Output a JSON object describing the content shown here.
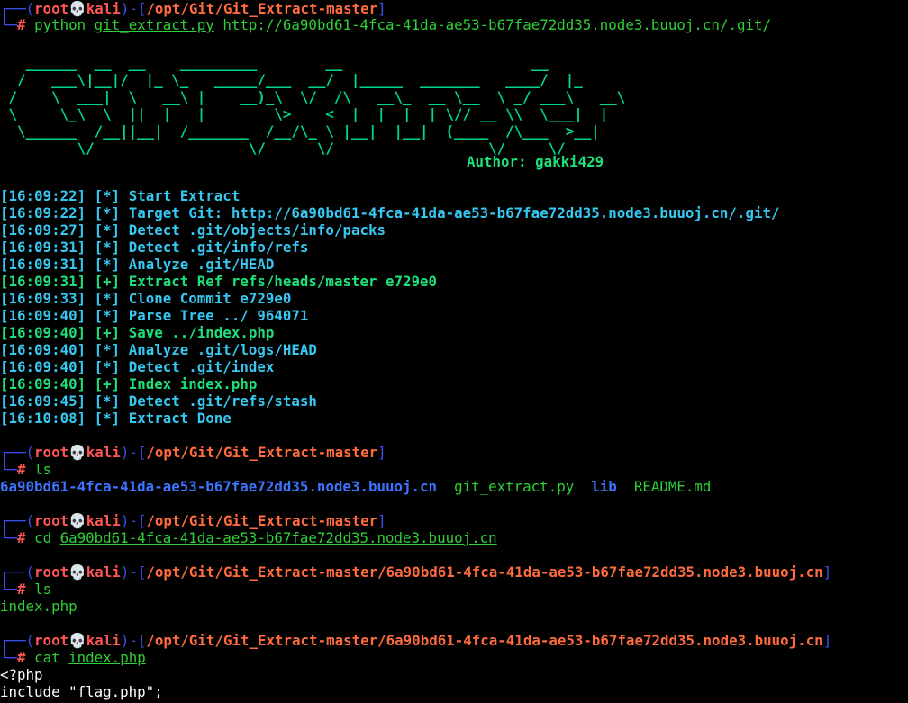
{
  "colors": {
    "background": "#000000",
    "prompt_bracket": "#3b4ef0",
    "prompt_user": "#ff5555",
    "prompt_path": "#ff6b3d",
    "command": "#2fd135",
    "log_info": "#36c8f0",
    "log_ok": "#1ee07a",
    "banner": "#00d88a",
    "dir_listing": "#3d74ff"
  },
  "prompt": {
    "corner_top": "┌──(",
    "user": "root",
    "skull": "💀",
    "host": "kali",
    "bracket_mid": ")-[",
    "bracket_close": "]",
    "corner_bottom": "└─",
    "hash": "#"
  },
  "session1": {
    "path": "/opt/Git/Git_Extract-master",
    "command": "python",
    "arg_file": "git_extract.py",
    "arg_url": "http://6a90bd61-4fca-41da-ae53-b67fae72dd35.node3.buuoj.cn/.git/"
  },
  "banner": {
    "art": [
      "   ______  __  __    _________        __                      __",
      "  /   ___\\|__|/  |_ \\_   _____/___  __/  |_____  _______   ____/  |_",
      " /    \\  ___|  \\   __\\ |    __)_\\  \\/  /\\   __\\_  __ \\__  \\ _/ ___\\   __\\",
      " \\     \\_\\  \\  ||  |   |        \\>    <  |  |  |  | \\// __ \\\\  \\___|  |",
      "  \\______  /__||__|  /_______  /__/\\_ \\ |__|  |__|  (____  /\\___  >__|",
      "         \\/                  \\/      \\/                  \\/     \\/"
    ],
    "author": "Author: gakki429"
  },
  "log": [
    {
      "time": "[16:09:22]",
      "tag": "[*]",
      "msg": "Start Extract",
      "kind": "info"
    },
    {
      "time": "[16:09:22]",
      "tag": "[*]",
      "msg": "Target Git: http://6a90bd61-4fca-41da-ae53-b67fae72dd35.node3.buuoj.cn/.git/",
      "kind": "info"
    },
    {
      "time": "[16:09:27]",
      "tag": "[*]",
      "msg": "Detect .git/objects/info/packs",
      "kind": "info"
    },
    {
      "time": "[16:09:31]",
      "tag": "[*]",
      "msg": "Detect .git/info/refs",
      "kind": "info"
    },
    {
      "time": "[16:09:31]",
      "tag": "[*]",
      "msg": "Analyze .git/HEAD",
      "kind": "info"
    },
    {
      "time": "[16:09:31]",
      "tag": "[+]",
      "msg": "Extract Ref refs/heads/master e729e0",
      "kind": "ok"
    },
    {
      "time": "[16:09:33]",
      "tag": "[*]",
      "msg": "Clone Commit e729e0",
      "kind": "info"
    },
    {
      "time": "[16:09:40]",
      "tag": "[*]",
      "msg": "Parse Tree ../ 964071",
      "kind": "info"
    },
    {
      "time": "[16:09:40]",
      "tag": "[+]",
      "msg": "Save ../index.php",
      "kind": "ok"
    },
    {
      "time": "[16:09:40]",
      "tag": "[*]",
      "msg": "Analyze .git/logs/HEAD",
      "kind": "info"
    },
    {
      "time": "[16:09:40]",
      "tag": "[*]",
      "msg": "Detect .git/index",
      "kind": "info"
    },
    {
      "time": "[16:09:40]",
      "tag": "[+]",
      "msg": "Index index.php",
      "kind": "ok"
    },
    {
      "time": "[16:09:45]",
      "tag": "[*]",
      "msg": "Detect .git/refs/stash",
      "kind": "info"
    },
    {
      "time": "[16:10:08]",
      "tag": "[*]",
      "msg": "Extract Done",
      "kind": "info"
    }
  ],
  "session2": {
    "path": "/opt/Git/Git_Extract-master",
    "command": "ls",
    "output_dir1": "6a90bd61-4fca-41da-ae53-b67fae72dd35.node3.buuoj.cn",
    "output_file1": "git_extract.py",
    "output_dir2": "lib",
    "output_file2": "README.md"
  },
  "session3": {
    "path": "/opt/Git/Git_Extract-master",
    "command": "cd",
    "arg": "6a90bd61-4fca-41da-ae53-b67fae72dd35.node3.buuoj.cn"
  },
  "session4": {
    "path": "/opt/Git/Git_Extract-master/6a90bd61-4fca-41da-ae53-b67fae72dd35.node3.buuoj.cn",
    "command": "ls",
    "output": "index.php"
  },
  "session5": {
    "path": "/opt/Git/Git_Extract-master/6a90bd61-4fca-41da-ae53-b67fae72dd35.node3.buuoj.cn",
    "command": "cat",
    "arg": "index.php",
    "output": [
      "<?php",
      "include \"flag.php\";"
    ]
  }
}
